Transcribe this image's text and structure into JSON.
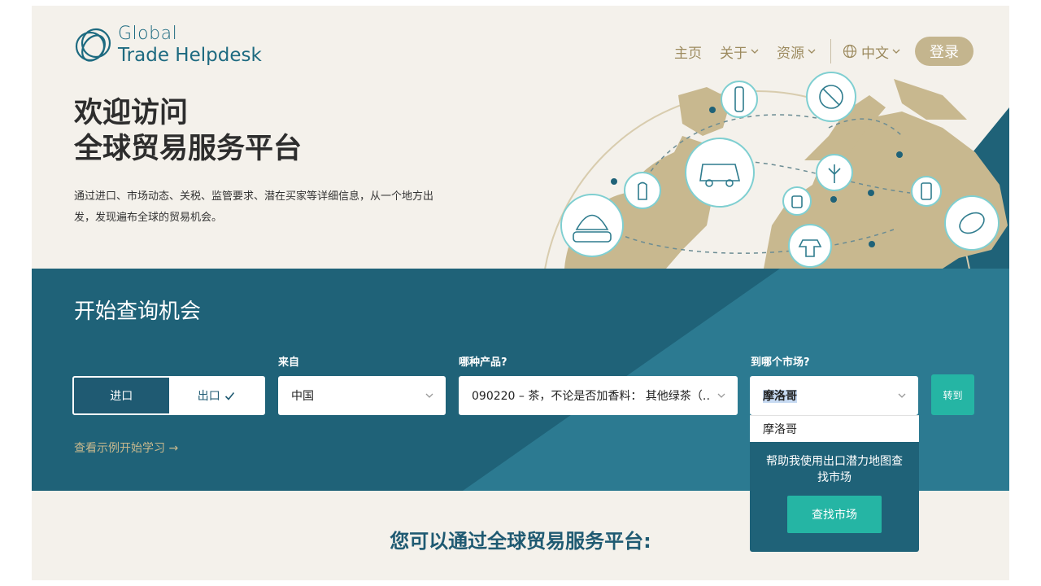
{
  "header": {
    "logo_line1": "Global",
    "logo_line2": "Trade Helpdesk",
    "nav": [
      {
        "label": "主页",
        "has_menu": false
      },
      {
        "label": "关于",
        "has_menu": true
      },
      {
        "label": "资源",
        "has_menu": true
      }
    ],
    "language": "中文",
    "login_label": "登录"
  },
  "hero": {
    "title_line1": "欢迎访问",
    "title_line2": "全球贸易服务平台",
    "subtitle": "通过进口、市场动态、关税、监管要求、潜在买家等详细信息，从一个地方出发，发现遍布全球的贸易机会。"
  },
  "search": {
    "title": "开始查询机会",
    "toggle": {
      "import_label": "进口",
      "export_label": "出口",
      "selected": "进口"
    },
    "from_label": "来自",
    "from_value": "中国",
    "product_label": "哪种产品?",
    "product_value": "090220 – 茶，不论是否加香料： 其他绿茶（…",
    "market_label": "到哪个市场?",
    "market_value": "摩洛哥",
    "go_label": "转到",
    "example_link": "查看示例开始学习 →"
  },
  "dropdown": {
    "option": "摩洛哥",
    "help_text": "帮助我使用出口潜力地图查找市场",
    "find_label": "查找市场"
  },
  "bottom": {
    "title": "您可以通过全球贸易服务平台:"
  },
  "colors": {
    "brand_teal": "#1f6278",
    "accent_green": "#25b5a4",
    "gold": "#c4b58e",
    "background": "#f4f1eb"
  }
}
